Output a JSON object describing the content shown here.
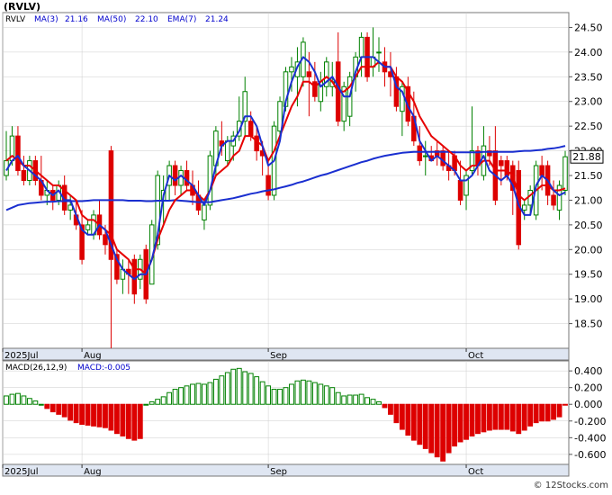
{
  "title": "(RVLV)",
  "watermark": "© 12Stocks.com",
  "price_legend": {
    "ticker": "RVLV",
    "items": [
      {
        "label": "MA(3)",
        "value": "21.16",
        "color": "#0000cc"
      },
      {
        "label": "MA(50)",
        "value": "22.10",
        "color": "#0000cc"
      },
      {
        "label": "EMA(7)",
        "value": "21.24",
        "color": "#0000cc"
      }
    ]
  },
  "macd_legend": {
    "params": "MACD(26,12,9)",
    "value_label": "MACD:-0.005",
    "color": "#0000cc"
  },
  "last_price_badge": "21.88",
  "colors": {
    "up": "#008000",
    "down": "#dd0000",
    "ma50": "#1a2fd0",
    "ema7": "#e60000",
    "ma3": "#1a2fd0",
    "axis_band": "#dfe6f2",
    "grid": "#cccccc"
  },
  "chart_data": [
    {
      "type": "candlestick",
      "ylim": [
        18.0,
        24.8
      ],
      "y_ticks": [
        "18.50",
        "19.00",
        "19.50",
        "20.00",
        "20.50",
        "21.00",
        "21.50",
        "22.00",
        "22.50",
        "23.00",
        "23.50",
        "24.00",
        "24.50"
      ],
      "x_labels": [
        {
          "label": "2025Jul",
          "index": 0
        },
        {
          "label": "Aug",
          "index": 13
        },
        {
          "label": "Sep",
          "index": 45
        },
        {
          "label": "Oct",
          "index": 79
        }
      ],
      "grid": true,
      "ohlc": [
        [
          21.5,
          22.4,
          21.4,
          21.8
        ],
        [
          21.8,
          22.5,
          21.7,
          22.3
        ],
        [
          22.3,
          22.5,
          21.5,
          21.6
        ],
        [
          21.6,
          21.9,
          21.3,
          21.4
        ],
        [
          21.4,
          21.9,
          21.3,
          21.8
        ],
        [
          21.8,
          21.9,
          21.3,
          21.4
        ],
        [
          21.4,
          21.9,
          21.0,
          21.1
        ],
        [
          21.1,
          21.4,
          20.9,
          21.2
        ],
        [
          21.2,
          21.3,
          20.8,
          21.0
        ],
        [
          21.0,
          21.4,
          20.9,
          21.3
        ],
        [
          21.3,
          21.5,
          20.7,
          20.8
        ],
        [
          20.8,
          21.1,
          20.6,
          20.9
        ],
        [
          20.7,
          21.0,
          20.4,
          20.5
        ],
        [
          20.5,
          20.8,
          19.7,
          19.8
        ],
        [
          20.4,
          20.6,
          20.3,
          20.5
        ],
        [
          20.3,
          20.8,
          20.2,
          20.7
        ],
        [
          20.7,
          21.0,
          20.2,
          20.3
        ],
        [
          20.3,
          20.5,
          19.9,
          20.1
        ],
        [
          22.0,
          22.1,
          18.0,
          19.8
        ],
        [
          19.9,
          20.0,
          19.3,
          19.4
        ],
        [
          19.4,
          19.8,
          19.1,
          19.6
        ],
        [
          19.6,
          19.8,
          19.1,
          19.5
        ],
        [
          19.8,
          19.9,
          18.9,
          19.1
        ],
        [
          19.4,
          19.9,
          19.2,
          19.8
        ],
        [
          20.0,
          20.1,
          18.9,
          19.0
        ],
        [
          19.3,
          20.6,
          19.3,
          20.5
        ],
        [
          20.1,
          21.6,
          20.0,
          21.5
        ],
        [
          21.0,
          21.5,
          20.5,
          21.2
        ],
        [
          21.3,
          21.8,
          21.0,
          21.7
        ],
        [
          21.7,
          21.8,
          21.1,
          21.3
        ],
        [
          21.3,
          21.7,
          21.1,
          21.6
        ],
        [
          21.6,
          21.8,
          21.2,
          21.3
        ],
        [
          21.3,
          21.6,
          20.9,
          21.1
        ],
        [
          21.1,
          21.4,
          20.7,
          20.8
        ],
        [
          20.6,
          21.0,
          20.4,
          20.9
        ],
        [
          20.9,
          22.0,
          20.8,
          21.9
        ],
        [
          21.7,
          22.5,
          21.5,
          22.4
        ],
        [
          22.2,
          22.6,
          21.9,
          22.1
        ],
        [
          21.8,
          22.3,
          21.7,
          22.2
        ],
        [
          22.1,
          22.4,
          21.8,
          22.3
        ],
        [
          22.3,
          23.1,
          22.2,
          22.6
        ],
        [
          22.6,
          23.5,
          22.3,
          23.2
        ],
        [
          22.6,
          22.8,
          22.2,
          22.3
        ],
        [
          22.3,
          22.5,
          21.8,
          22.0
        ],
        [
          22.0,
          22.2,
          21.5,
          21.9
        ],
        [
          21.5,
          21.8,
          21.0,
          21.1
        ],
        [
          21.1,
          22.6,
          21.0,
          22.5
        ],
        [
          22.4,
          23.1,
          22.2,
          23.0
        ],
        [
          22.9,
          23.7,
          22.8,
          23.6
        ],
        [
          23.6,
          23.9,
          23.2,
          23.7
        ],
        [
          23.5,
          24.1,
          22.9,
          23.8
        ],
        [
          23.5,
          24.3,
          23.3,
          24.2
        ],
        [
          23.6,
          24.0,
          22.7,
          23.5
        ],
        [
          23.4,
          23.8,
          23.0,
          23.1
        ],
        [
          23.0,
          23.6,
          22.8,
          23.4
        ],
        [
          23.3,
          23.9,
          23.1,
          23.8
        ],
        [
          23.3,
          23.8,
          23.1,
          23.4
        ],
        [
          23.8,
          24.4,
          22.5,
          22.6
        ],
        [
          22.6,
          23.4,
          22.4,
          23.3
        ],
        [
          22.7,
          23.6,
          22.5,
          23.5
        ],
        [
          23.5,
          24.0,
          23.2,
          23.9
        ],
        [
          23.9,
          24.4,
          23.5,
          24.3
        ],
        [
          24.3,
          24.4,
          23.4,
          23.5
        ],
        [
          23.7,
          24.5,
          23.5,
          23.9
        ],
        [
          24.0,
          24.3,
          23.6,
          24.0
        ],
        [
          23.8,
          24.1,
          23.3,
          23.6
        ],
        [
          23.6,
          24.0,
          23.1,
          23.5
        ],
        [
          23.5,
          23.7,
          22.8,
          22.9
        ],
        [
          22.8,
          23.4,
          22.3,
          23.3
        ],
        [
          23.3,
          23.5,
          22.5,
          22.6
        ],
        [
          22.7,
          23.2,
          22.1,
          22.2
        ],
        [
          22.1,
          22.5,
          21.7,
          21.8
        ],
        [
          21.9,
          22.2,
          21.5,
          21.9
        ],
        [
          21.9,
          22.1,
          21.8,
          21.8
        ],
        [
          22.0,
          22.2,
          21.7,
          21.9
        ],
        [
          22.0,
          22.1,
          21.6,
          21.7
        ],
        [
          21.7,
          22.0,
          21.4,
          21.6
        ],
        [
          21.9,
          22.0,
          21.5,
          21.6
        ],
        [
          21.4,
          21.8,
          20.9,
          21.0
        ],
        [
          21.1,
          21.6,
          20.8,
          21.5
        ],
        [
          21.6,
          22.9,
          21.5,
          22.0
        ],
        [
          22.0,
          22.1,
          21.5,
          21.7
        ],
        [
          21.5,
          22.5,
          21.4,
          22.1
        ],
        [
          22.0,
          22.3,
          21.7,
          21.9
        ],
        [
          22.0,
          22.5,
          20.9,
          21.0
        ],
        [
          21.8,
          21.9,
          21.3,
          21.7
        ],
        [
          21.8,
          21.9,
          21.4,
          21.5
        ],
        [
          21.7,
          21.8,
          20.7,
          21.2
        ],
        [
          21.6,
          21.8,
          20.0,
          20.1
        ],
        [
          20.8,
          21.0,
          20.6,
          20.9
        ],
        [
          20.9,
          21.3,
          20.7,
          21.2
        ],
        [
          20.7,
          21.8,
          20.6,
          21.7
        ],
        [
          21.7,
          21.9,
          21.2,
          21.5
        ],
        [
          21.7,
          21.8,
          20.9,
          21.1
        ],
        [
          21.1,
          21.4,
          20.8,
          20.9
        ],
        [
          20.8,
          21.4,
          20.6,
          21.3
        ],
        [
          21.2,
          22.0,
          21.1,
          21.88
        ]
      ],
      "ema7": [
        21.8,
        21.9,
        21.8,
        21.7,
        21.7,
        21.6,
        21.5,
        21.4,
        21.3,
        21.3,
        21.2,
        21.1,
        21.0,
        20.7,
        20.6,
        20.6,
        20.5,
        20.4,
        20.3,
        20.0,
        19.9,
        19.8,
        19.6,
        19.6,
        19.5,
        19.8,
        20.2,
        20.5,
        20.8,
        21.0,
        21.1,
        21.2,
        21.2,
        21.1,
        21.0,
        21.2,
        21.5,
        21.6,
        21.7,
        21.9,
        22.0,
        22.3,
        22.3,
        22.2,
        22.1,
        21.8,
        22.0,
        22.3,
        22.6,
        22.9,
        23.1,
        23.4,
        23.4,
        23.3,
        23.4,
        23.5,
        23.4,
        23.2,
        23.2,
        23.3,
        23.5,
        23.7,
        23.7,
        23.7,
        23.8,
        23.7,
        23.7,
        23.5,
        23.4,
        23.2,
        23.0,
        22.7,
        22.5,
        22.3,
        22.2,
        22.1,
        22.0,
        21.9,
        21.7,
        21.6,
        21.7,
        21.7,
        21.8,
        21.8,
        21.6,
        21.6,
        21.6,
        21.5,
        21.1,
        21.0,
        21.1,
        21.2,
        21.3,
        21.3,
        21.2,
        21.2,
        21.24
      ],
      "ma3": [
        21.6,
        21.8,
        21.9,
        21.7,
        21.6,
        21.5,
        21.4,
        21.2,
        21.1,
        21.2,
        21.0,
        21.0,
        20.7,
        20.4,
        20.3,
        20.3,
        20.5,
        20.4,
        20.1,
        19.8,
        19.6,
        19.5,
        19.4,
        19.5,
        19.5,
        19.8,
        20.3,
        21.1,
        21.5,
        21.4,
        21.5,
        21.4,
        21.3,
        21.1,
        20.9,
        21.2,
        21.7,
        22.1,
        22.2,
        22.2,
        22.4,
        22.7,
        22.7,
        22.5,
        22.1,
        21.7,
        21.8,
        22.2,
        23.0,
        23.4,
        23.7,
        23.9,
        23.8,
        23.6,
        23.3,
        23.4,
        23.5,
        23.3,
        23.1,
        23.1,
        23.6,
        23.9,
        23.9,
        23.9,
        23.8,
        23.7,
        23.7,
        23.3,
        23.2,
        22.9,
        22.7,
        22.2,
        22.0,
        21.8,
        21.9,
        21.8,
        21.7,
        21.6,
        21.4,
        21.4,
        21.5,
        21.7,
        21.9,
        21.6,
        21.5,
        21.4,
        21.5,
        21.3,
        20.9,
        20.7,
        20.7,
        21.3,
        21.5,
        21.4,
        21.2,
        21.1,
        21.16
      ],
      "ma50": [
        20.8,
        20.85,
        20.9,
        20.92,
        20.94,
        20.95,
        20.96,
        20.97,
        20.97,
        20.98,
        20.98,
        20.98,
        20.98,
        20.98,
        20.99,
        21.0,
        21.0,
        21.0,
        21.0,
        21.0,
        21.0,
        20.99,
        20.99,
        20.99,
        20.98,
        20.98,
        20.99,
        20.99,
        20.99,
        21.0,
        20.99,
        20.98,
        20.97,
        20.96,
        20.96,
        20.96,
        20.98,
        21.0,
        21.02,
        21.04,
        21.07,
        21.1,
        21.13,
        21.15,
        21.18,
        21.2,
        21.22,
        21.25,
        21.28,
        21.31,
        21.35,
        21.38,
        21.42,
        21.46,
        21.5,
        21.53,
        21.57,
        21.61,
        21.65,
        21.69,
        21.73,
        21.77,
        21.8,
        21.84,
        21.87,
        21.9,
        21.92,
        21.94,
        21.96,
        21.97,
        21.98,
        21.98,
        21.98,
        21.98,
        21.98,
        21.98,
        21.98,
        21.97,
        21.97,
        21.97,
        21.97,
        21.97,
        21.98,
        21.98,
        21.98,
        21.98,
        21.98,
        21.98,
        21.99,
        22.0,
        22.0,
        22.01,
        22.02,
        22.04,
        22.05,
        22.07,
        22.1
      ],
      "overlay_labels": [
        "MA(3)",
        "MA(50)",
        "EMA(7)"
      ]
    },
    {
      "type": "bar",
      "name": "MACD(26,12,9)",
      "ylim": [
        -0.72,
        0.52
      ],
      "y_ticks": [
        "0.400",
        "0.200",
        "0.000",
        "-0.200",
        "-0.400",
        "-0.600"
      ],
      "x_labels": [
        {
          "label": "2025Jul",
          "index": 0
        },
        {
          "label": "Aug",
          "index": 13
        },
        {
          "label": "Sep",
          "index": 45
        },
        {
          "label": "Oct",
          "index": 79
        }
      ],
      "values": [
        0.1,
        0.12,
        0.13,
        0.1,
        0.07,
        0.04,
        0.0,
        -0.05,
        -0.09,
        -0.12,
        -0.15,
        -0.19,
        -0.22,
        -0.24,
        -0.25,
        -0.26,
        -0.27,
        -0.28,
        -0.31,
        -0.35,
        -0.38,
        -0.41,
        -0.43,
        -0.41,
        0.0,
        0.03,
        0.06,
        0.09,
        0.14,
        0.18,
        0.2,
        0.22,
        0.24,
        0.25,
        0.24,
        0.26,
        0.3,
        0.34,
        0.38,
        0.42,
        0.43,
        0.39,
        0.37,
        0.33,
        0.27,
        0.22,
        0.18,
        0.18,
        0.2,
        0.24,
        0.28,
        0.29,
        0.28,
        0.26,
        0.24,
        0.22,
        0.2,
        0.14,
        0.1,
        0.11,
        0.11,
        0.12,
        0.08,
        0.06,
        0.03,
        -0.04,
        -0.12,
        -0.22,
        -0.3,
        -0.37,
        -0.43,
        -0.48,
        -0.53,
        -0.58,
        -0.63,
        -0.68,
        -0.58,
        -0.5,
        -0.45,
        -0.42,
        -0.38,
        -0.35,
        -0.33,
        -0.31,
        -0.3,
        -0.3,
        -0.3,
        -0.32,
        -0.35,
        -0.31,
        -0.26,
        -0.22,
        -0.2,
        -0.2,
        -0.18,
        -0.15,
        -0.005
      ]
    }
  ]
}
